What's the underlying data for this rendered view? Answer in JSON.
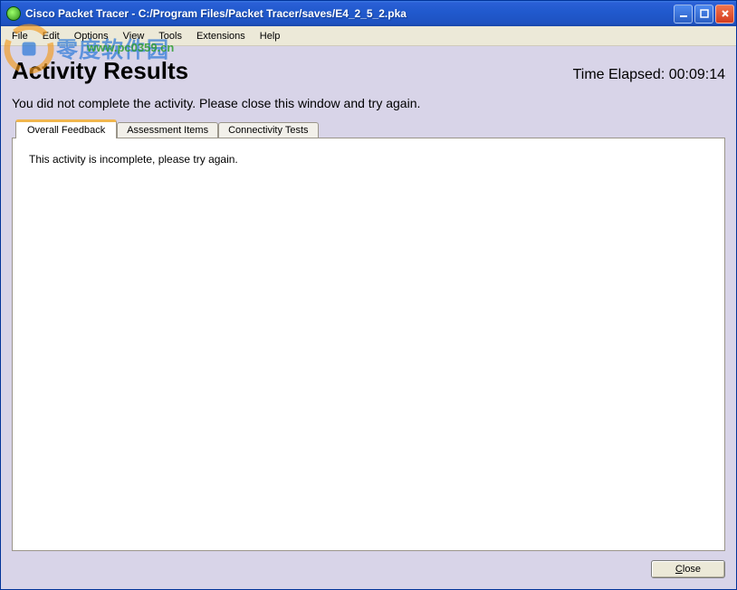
{
  "titlebar": {
    "title": "Cisco Packet Tracer - C:/Program Files/Packet Tracer/saves/E4_2_5_2.pka"
  },
  "menubar": {
    "items": [
      "File",
      "Edit",
      "Options",
      "View",
      "Tools",
      "Extensions",
      "Help"
    ]
  },
  "watermark": {
    "url": "www.pc0359.cn",
    "cn_text": "零度软件园"
  },
  "header": {
    "title": "Activity Results",
    "time_label": "Time Elapsed: ",
    "time_value": "00:09:14"
  },
  "status_message": "You did not complete the activity. Please close this window and try again.",
  "tabs": [
    {
      "label": "Overall Feedback",
      "active": true
    },
    {
      "label": "Assessment Items",
      "active": false
    },
    {
      "label": "Connectivity Tests",
      "active": false
    }
  ],
  "tab_content": {
    "overall_feedback": "This activity is incomplete, please try again."
  },
  "footer": {
    "close_prefix": "C",
    "close_suffix": "lose"
  }
}
